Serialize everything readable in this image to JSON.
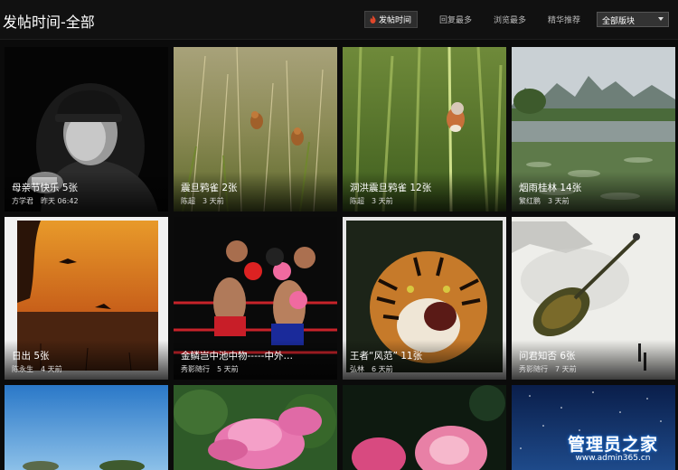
{
  "header": {
    "title": "发帖时间-全部",
    "sort_tabs": [
      "发帖时间",
      "回复最多",
      "浏览最多",
      "精华推荐"
    ],
    "forum_select": "全部版块"
  },
  "cards": [
    {
      "title": "母亲节快乐 5张",
      "author": "方学君",
      "time": "昨天 06:42"
    },
    {
      "title": "震旦鸦雀 2张",
      "author": "陈超",
      "time": "3 天前"
    },
    {
      "title": "洞洪震旦鸦雀 12张",
      "author": "陈超",
      "time": "3 天前"
    },
    {
      "title": "烟雨桂林 14张",
      "author": "繁红鹏",
      "time": "3 天前"
    },
    {
      "title": "日出 5张",
      "author": "陈永生",
      "time": "4 天前"
    },
    {
      "title": "金鳞岂中池中物-----中外…",
      "author": "秀影随行",
      "time": "5 天前"
    },
    {
      "title": "王者“风范” 11张",
      "author": "弘林",
      "time": "6 天前"
    },
    {
      "title": "问君知否 6张",
      "author": "秀影随行",
      "time": "7 天前"
    }
  ],
  "watermark": {
    "main": "管理员之家",
    "sub": "www.admin365.cn"
  },
  "colors": {
    "accent_flame": "#e0472a",
    "watermark_glow": "#1e6fd0"
  }
}
